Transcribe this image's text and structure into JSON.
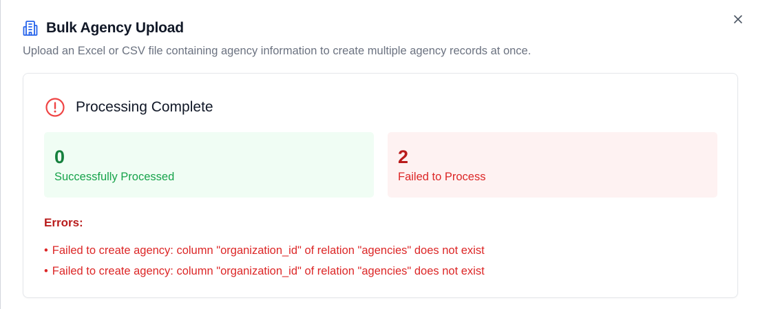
{
  "dialog": {
    "title": "Bulk Agency Upload",
    "description": "Upload an Excel or CSV file containing agency information to create multiple agency records at once.",
    "close_icon": "close-icon",
    "header_icon": "building-icon"
  },
  "result": {
    "status_icon": "alert-circle-icon",
    "status_title": "Processing Complete",
    "success": {
      "value": "0",
      "label": "Successfully Processed"
    },
    "failed": {
      "value": "2",
      "label": "Failed to Process"
    },
    "errors_heading": "Errors:",
    "errors": [
      "Failed to create agency: column \"organization_id\" of relation \"agencies\" does not exist",
      "Failed to create agency: column \"organization_id\" of relation \"agencies\" does not exist"
    ]
  },
  "colors": {
    "accent": "#2563eb",
    "success_bg": "#f0fdf4",
    "success_text": "#15803d",
    "error_bg": "#fef2f2",
    "error_text": "#dc2626"
  }
}
